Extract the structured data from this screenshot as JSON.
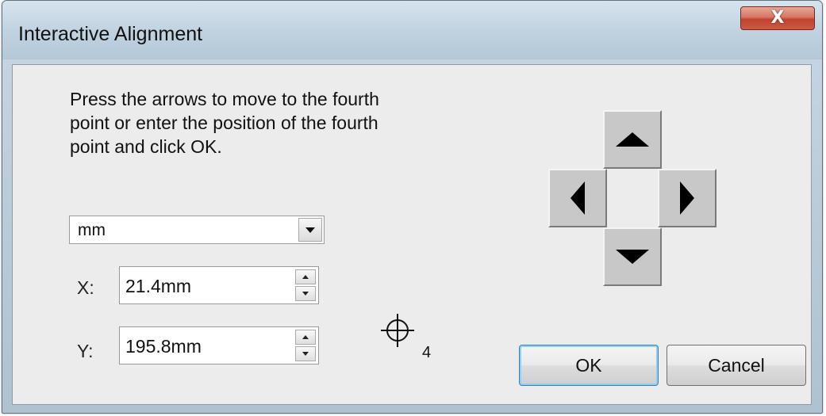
{
  "window": {
    "title": "Interactive Alignment",
    "close_label": "X"
  },
  "instructions": "Press the arrows to move to the fourth\npoint or enter the position of the fourth\npoint and click OK.",
  "units": {
    "selected": "mm"
  },
  "fields": {
    "x": {
      "label": "X:",
      "value": "21.4mm"
    },
    "y": {
      "label": "Y:",
      "value": "195.8mm"
    }
  },
  "marker": {
    "icon": "crosshair-icon",
    "subscript": "4"
  },
  "nudge": {
    "icons": [
      "arrow-up-icon",
      "arrow-left-icon",
      "arrow-right-icon",
      "arrow-down-icon"
    ]
  },
  "buttons": {
    "ok": "OK",
    "cancel": "Cancel"
  },
  "colors": {
    "titlebar": "#c1d3e1",
    "close_button": "#c2432e",
    "client_background": "#ececec",
    "arrow_button": "#c8c8c8"
  }
}
